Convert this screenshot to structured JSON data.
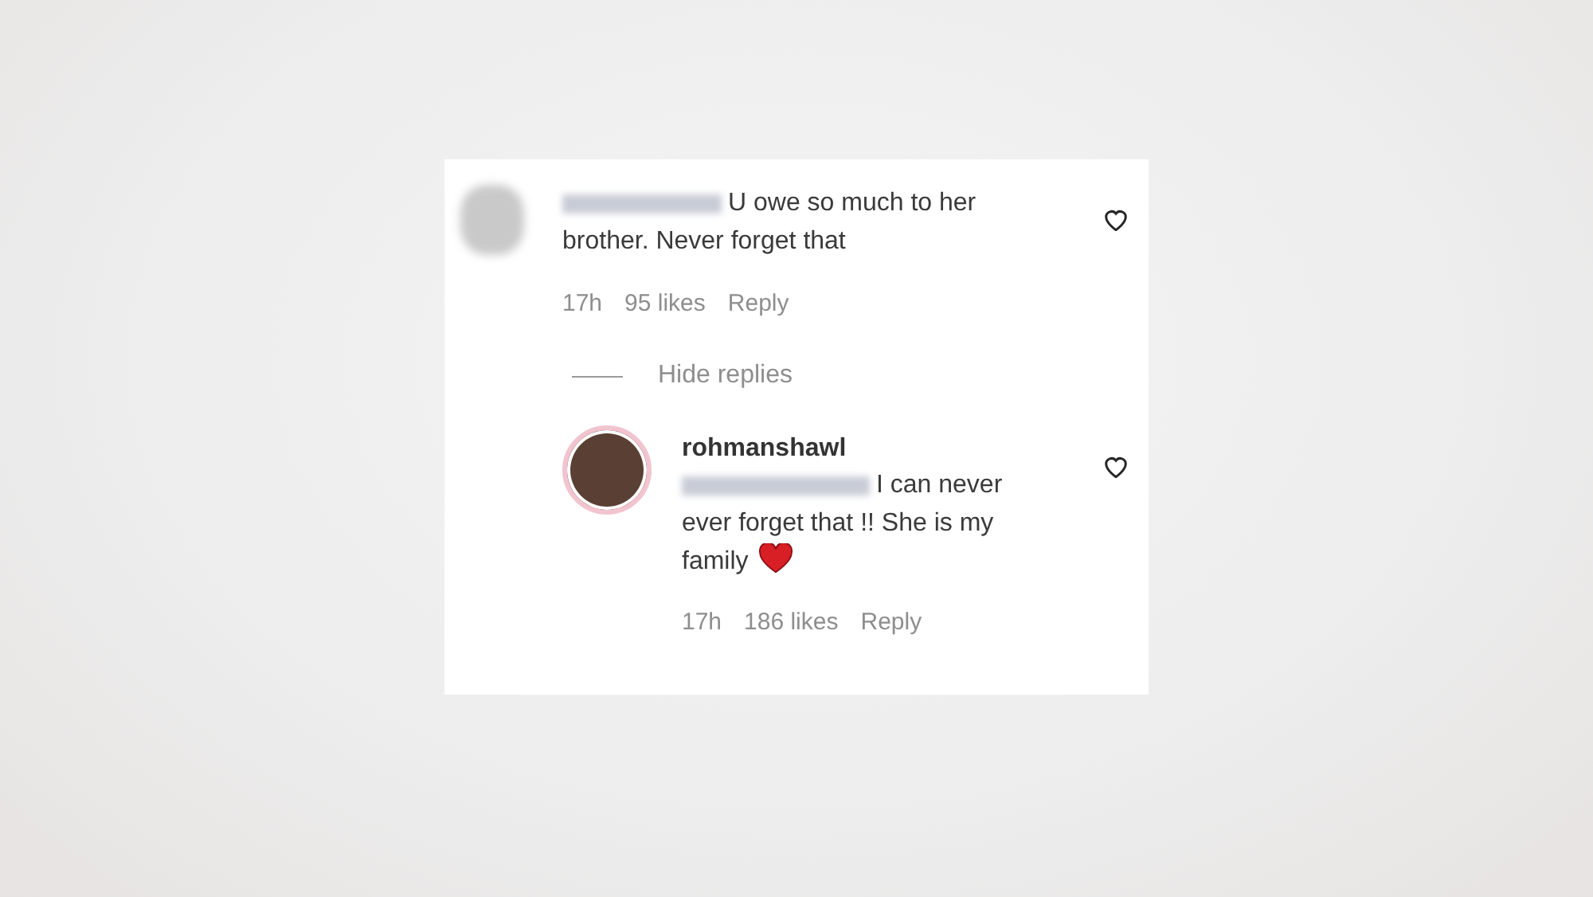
{
  "comment": {
    "avatar": {
      "kind": "blurred"
    },
    "username_blurred": true,
    "text": "U owe so much to her brother. Never forget that",
    "liked": false,
    "time": "17h",
    "likes": "95 likes",
    "reply_label": "Reply"
  },
  "toggle": {
    "label": "Hide replies"
  },
  "reply": {
    "avatar": {
      "kind": "photo"
    },
    "username": "rohmanshawl",
    "mention_blurred": true,
    "text": "I can never ever forget that !! She is my family",
    "emoji": {
      "kind": "heart"
    },
    "liked": false,
    "time": "17h",
    "likes": "186 likes",
    "reply_label": "Reply"
  }
}
